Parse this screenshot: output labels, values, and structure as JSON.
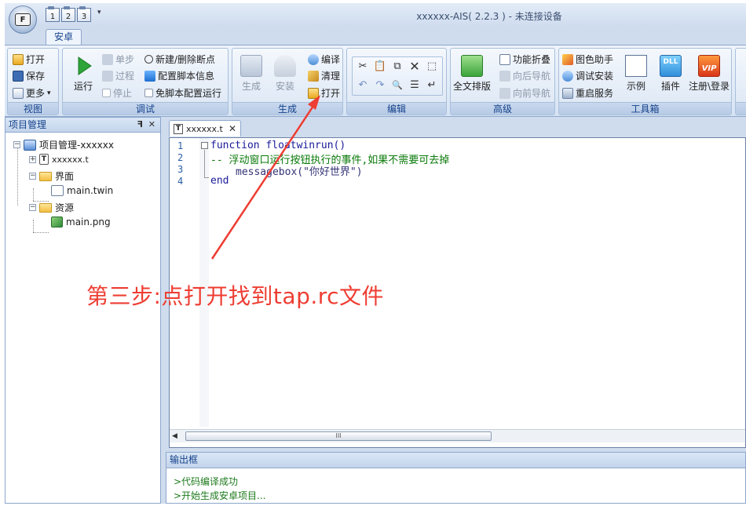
{
  "window": {
    "title": "xxxxxx-AIS( 2.2.3 ) - 未连接设备",
    "orb_letter": "F",
    "qat_buttons": [
      "1",
      "2",
      "3"
    ]
  },
  "ribbon": {
    "active_tab": "安卓",
    "groups": {
      "view": {
        "label": "视图",
        "open": "打开",
        "save": "保存",
        "more": "更多"
      },
      "debug": {
        "label": "调试",
        "run": "运行",
        "step": "单步",
        "process": "过程",
        "stop": "停止",
        "new_breakpoint": "新建/删除断点",
        "config_script": "配置脚本信息",
        "no_config_run": "免脚本配置运行"
      },
      "build": {
        "label": "生成",
        "generate": "生成",
        "install": "安装",
        "compile": "编译",
        "clean": "清理",
        "open": "打开"
      },
      "edit": {
        "label": "编辑"
      },
      "advanced": {
        "label": "高级",
        "full_layout": "全文排版",
        "fold": "功能折叠",
        "back_nav": "向后导航",
        "forward_nav": "向前导航"
      },
      "toolbox": {
        "label": "工具箱",
        "color_helper": "图色助手",
        "debug_install": "调试安装",
        "restart_service": "重启服务",
        "example": "示例",
        "plugin": "插件",
        "register_login": "注册\\登录",
        "dll_badge": "DLL",
        "vip_badge": "VIP"
      }
    }
  },
  "project_panel": {
    "title": "项目管理",
    "pin": "ᵖ",
    "close": "✕",
    "tree": {
      "root": "项目管理-xxxxxx",
      "file_t": "xxxxxx.t",
      "ui_folder": "界面",
      "ui_file": "main.twin",
      "res_folder": "资源",
      "res_file": "main.png"
    }
  },
  "editor": {
    "tab_label": "xxxxxx.t",
    "tab_icon_letter": "T",
    "tab_close": "✕",
    "line_numbers": [
      "1",
      "2",
      "3",
      "4"
    ],
    "code": [
      "function floatwinrun()",
      "-- 浮动窗口运行按钮执行的事件,如果不需要可去掉",
      "messagebox(\"你好世界\")",
      "end"
    ],
    "scroll_thumb": "III"
  },
  "output": {
    "title": "输出框",
    "lines": [
      ">代码编译成功",
      ">开始生成安卓项目..."
    ]
  },
  "annotation": {
    "text": "第三步:点打开找到tap.rc文件",
    "color": "#ee3d32"
  }
}
